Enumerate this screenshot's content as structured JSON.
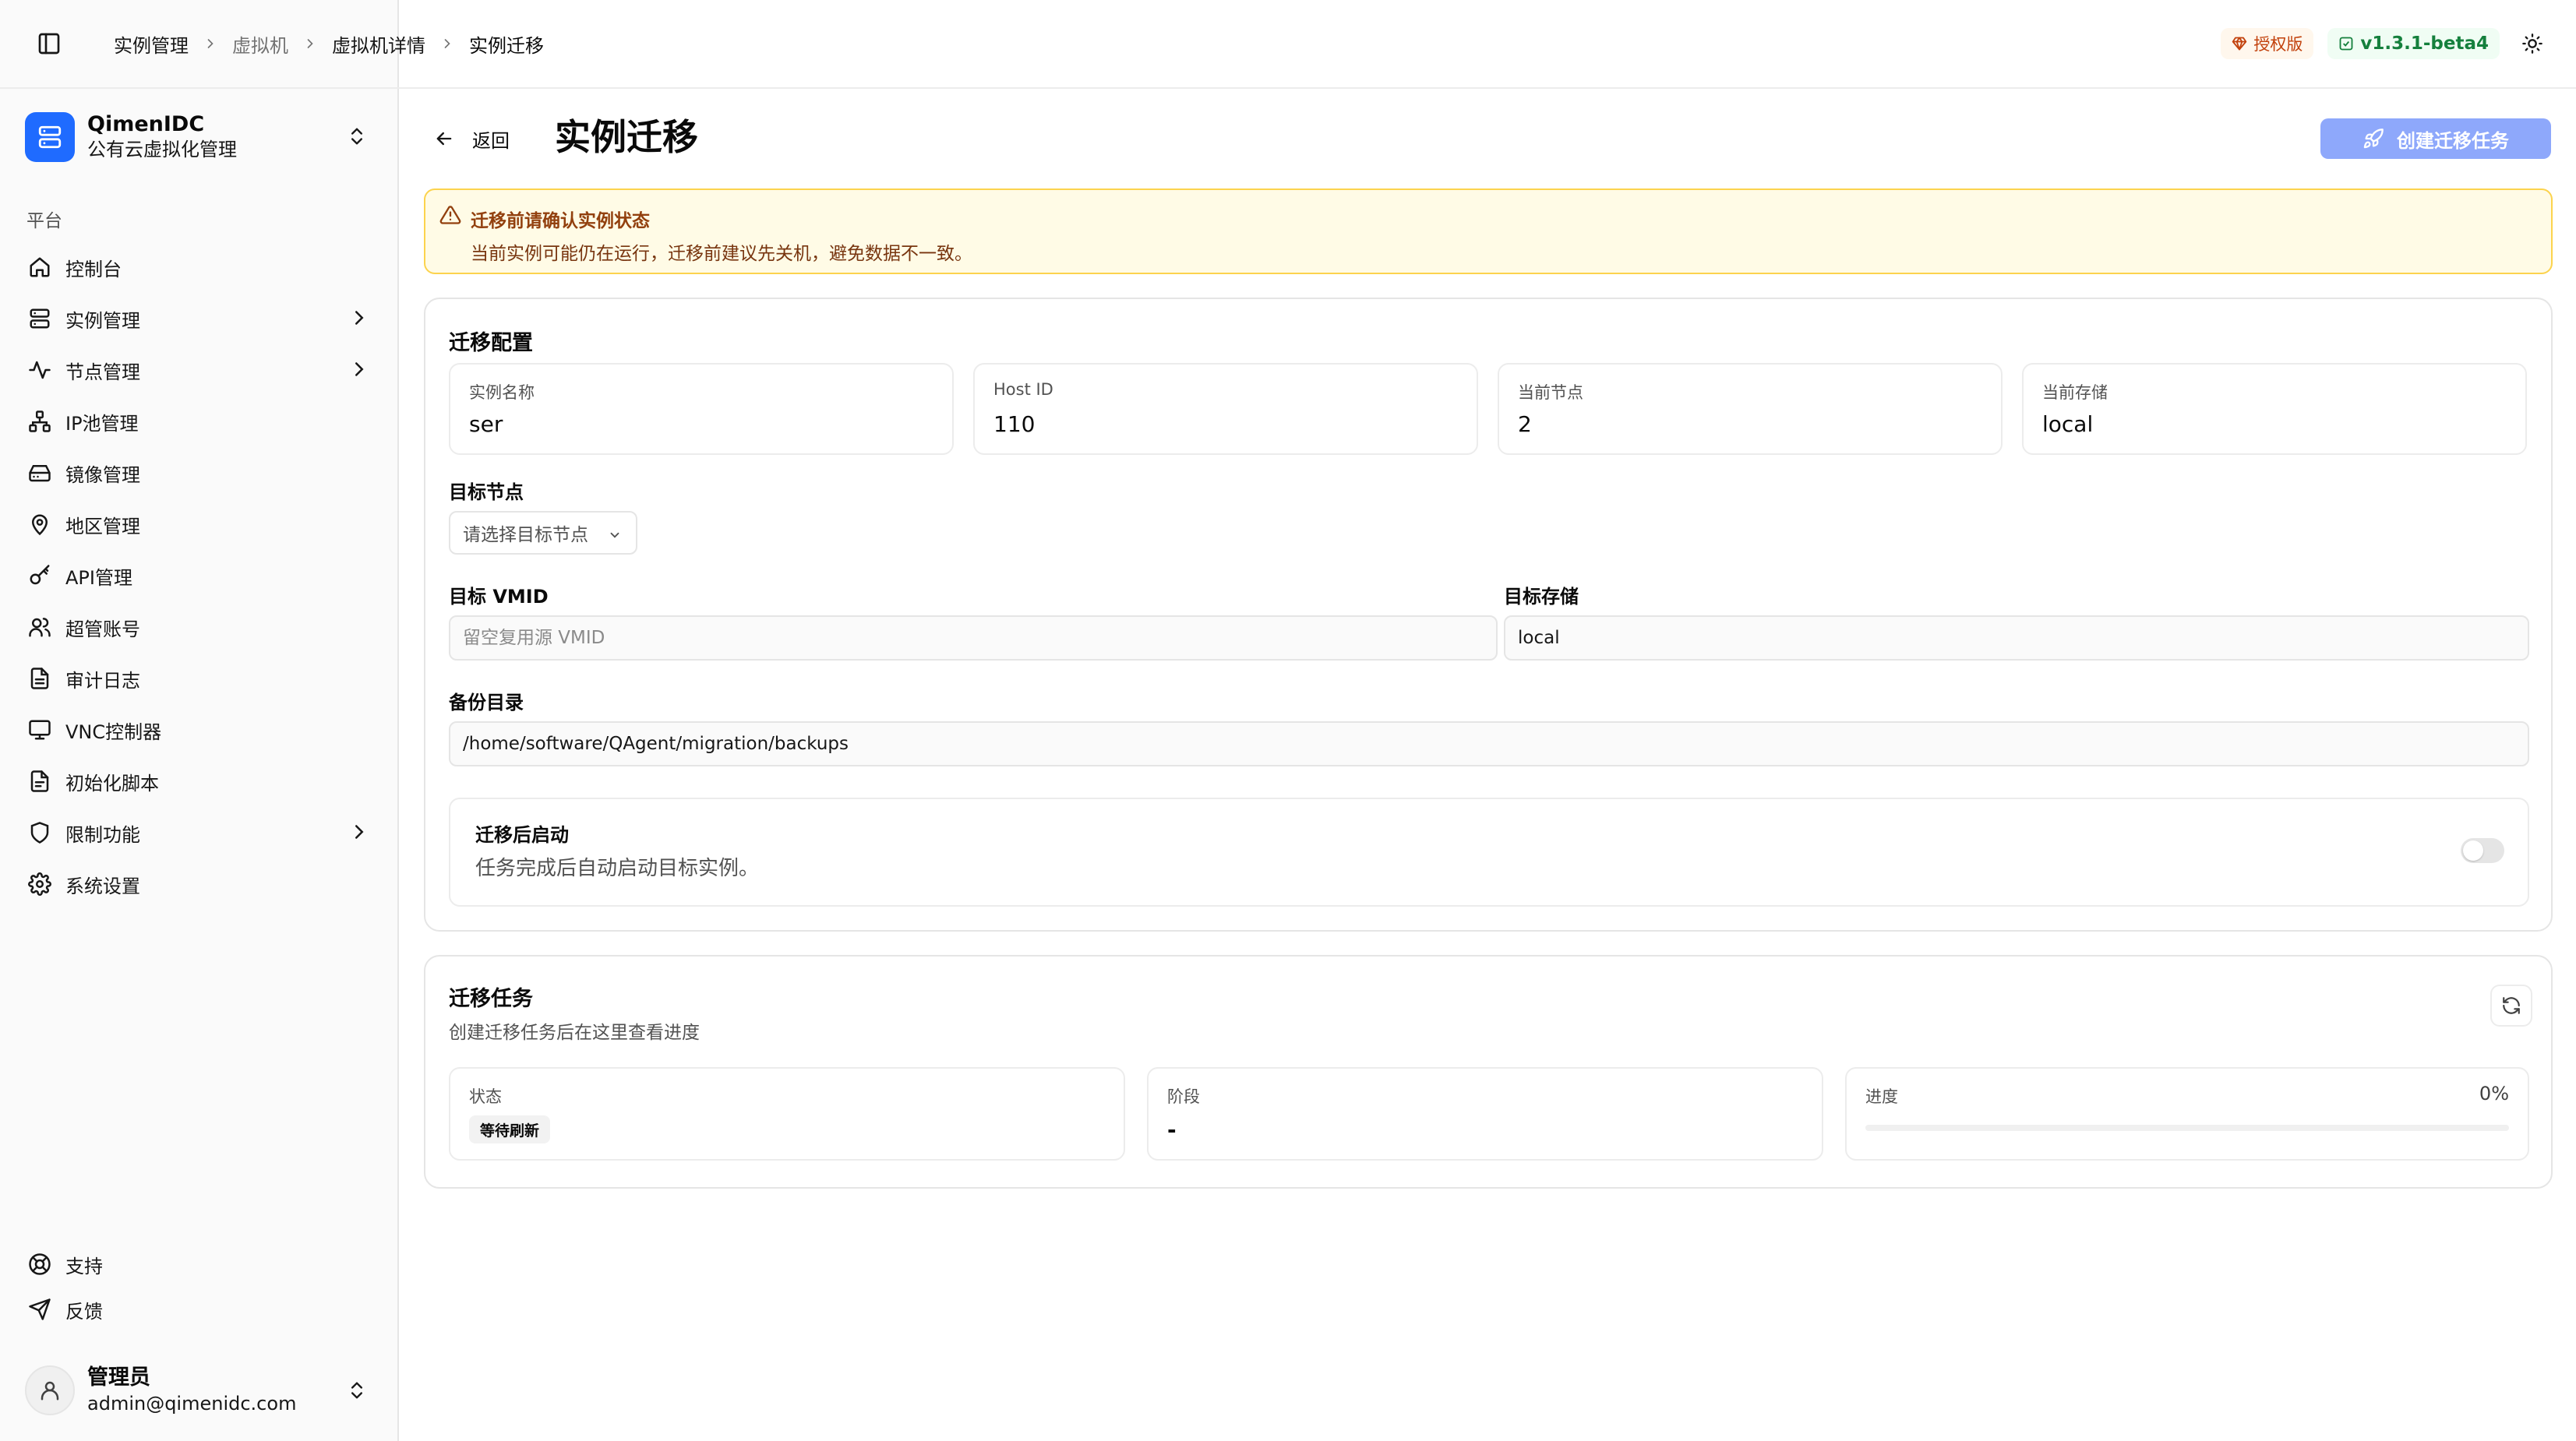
{
  "breadcrumb": {
    "items": [
      "实例管理",
      "虚拟机",
      "虚拟机详情",
      "实例迁移"
    ]
  },
  "header": {
    "license_badge": "授权版",
    "version_badge": "v1.3.1-beta4"
  },
  "brand": {
    "name": "QimenIDC",
    "subtitle": "公有云虚拟化管理"
  },
  "sidebar": {
    "group_label": "平台",
    "items": [
      {
        "label": "控制台",
        "icon": "home-icon"
      },
      {
        "label": "实例管理",
        "icon": "server-icon"
      },
      {
        "label": "节点管理",
        "icon": "activity-icon"
      },
      {
        "label": "IP池管理",
        "icon": "network-icon"
      },
      {
        "label": "镜像管理",
        "icon": "hard-drive-icon"
      },
      {
        "label": "地区管理",
        "icon": "map-pin-icon"
      },
      {
        "label": "API管理",
        "icon": "key-icon"
      },
      {
        "label": "超管账号",
        "icon": "users-icon"
      },
      {
        "label": "审计日志",
        "icon": "file-text-icon"
      },
      {
        "label": "VNC控制器",
        "icon": "monitor-icon"
      },
      {
        "label": "初始化脚本",
        "icon": "file-icon"
      },
      {
        "label": "限制功能",
        "icon": "shield-icon"
      },
      {
        "label": "系统设置",
        "icon": "gear-icon"
      }
    ],
    "bottom": [
      {
        "label": "支持",
        "icon": "life-buoy-icon"
      },
      {
        "label": "反馈",
        "icon": "send-icon"
      }
    ],
    "user": {
      "name": "管理员",
      "email": "admin@qimenidc.com"
    }
  },
  "page": {
    "back_label": "返回",
    "title": "实例迁移",
    "create_button": "创建迁移任务"
  },
  "alert": {
    "title": "迁移前请确认实例状态",
    "description": "当前实例可能仍在运行，迁移前建议先关机，避免数据不一致。"
  },
  "config": {
    "title": "迁移配置",
    "info": [
      {
        "label": "实例名称",
        "value": "ser"
      },
      {
        "label": "Host ID",
        "value": "110"
      },
      {
        "label": "当前节点",
        "value": "2"
      },
      {
        "label": "当前存储",
        "value": "local"
      }
    ],
    "target_node_label": "目标节点",
    "target_node_placeholder": "请选择目标节点",
    "target_vmid_label": "目标 VMID",
    "target_vmid_placeholder": "留空复用源 VMID",
    "target_storage_label": "目标存储",
    "target_storage_value": "local",
    "backup_dir_label": "备份目录",
    "backup_dir_value": "/home/software/QAgent/migration/backups",
    "autostart_title": "迁移后启动",
    "autostart_desc": "任务完成后自动启动目标实例。",
    "autostart_enabled": false
  },
  "tasks": {
    "title": "迁移任务",
    "subtitle": "创建迁移任务后在这里查看进度",
    "status_label": "状态",
    "status_value": "等待刷新",
    "stage_label": "阶段",
    "stage_value": "-",
    "progress_label": "进度",
    "progress_text": "0%",
    "progress_percent": 0
  }
}
